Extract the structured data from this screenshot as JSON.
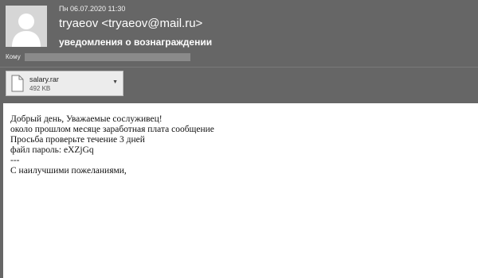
{
  "header": {
    "date": "Пн 06.07.2020 11:30",
    "sender": "tryaeov <tryaeov@mail.ru>",
    "subject": "уведомления о вознаграждении",
    "to_label": "Кому"
  },
  "attachment": {
    "name": "salary.rar",
    "size": "492 KB"
  },
  "body": {
    "lines": [
      "Добрый день, Уважаемые сослуживец!",
      "около прошлом месяце заработная плата сообщение",
      "Просьба проверьте течение 3 дней",
      "файл пароль: eXZjGq",
      "---",
      "С наилучшими пожеланиями,"
    ]
  },
  "colors": {
    "header_bg": "#666666",
    "body_bg": "#ffffff",
    "attachment_bg": "#ececec"
  }
}
